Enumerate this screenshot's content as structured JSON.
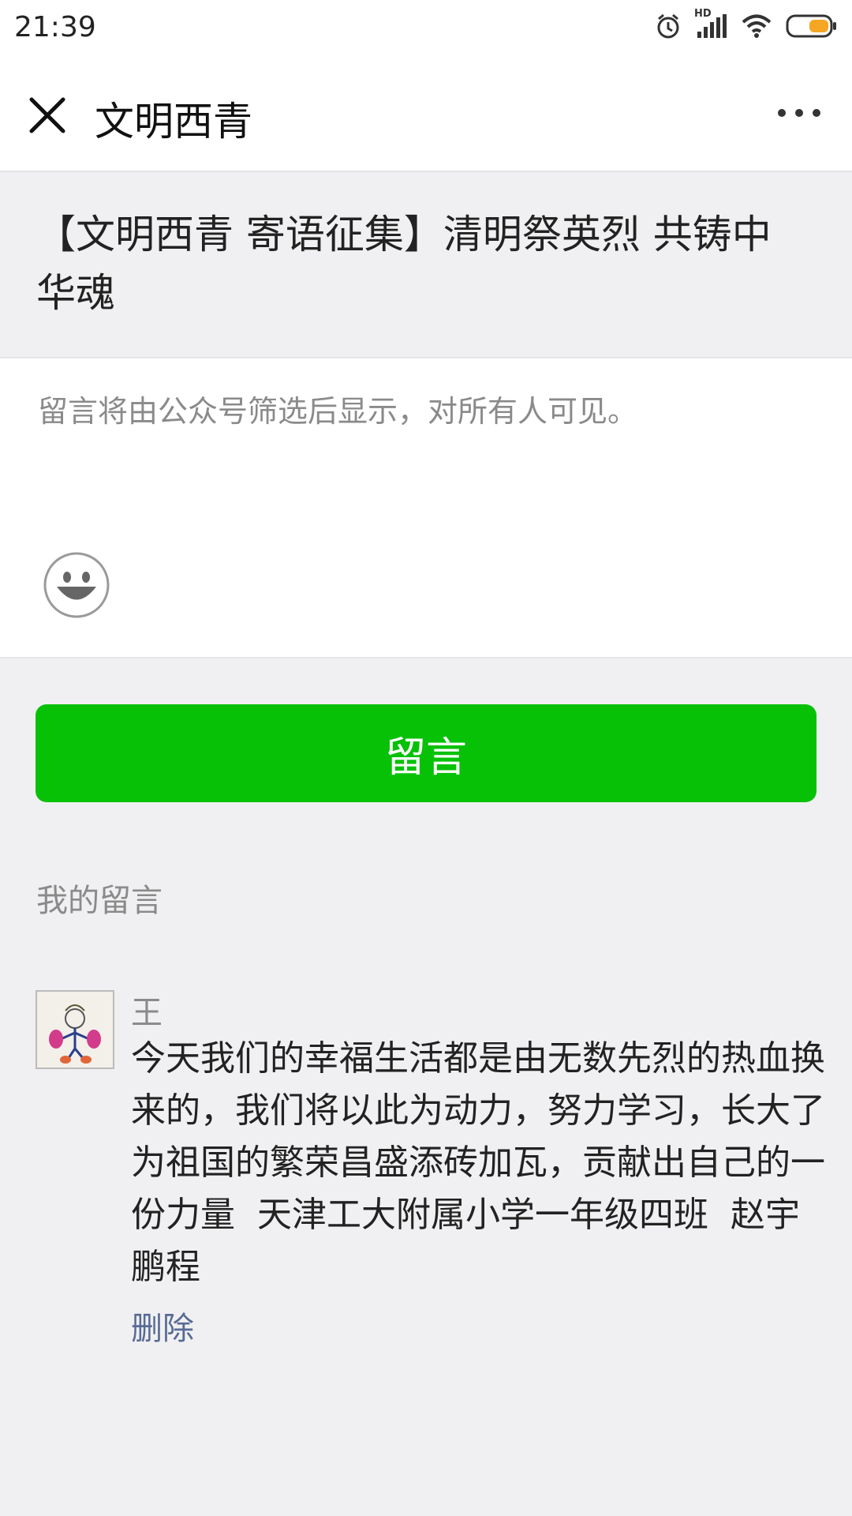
{
  "status_bar": {
    "time": "21:39",
    "hd_label": "HD",
    "icons": [
      "alarm-icon",
      "signal-icon",
      "wifi-icon",
      "battery-icon"
    ]
  },
  "nav": {
    "title": "文明西青",
    "close_icon": "close-icon",
    "more_icon": "more-icon"
  },
  "article": {
    "title": "【文明西青 寄语征集】清明祭英烈 共铸中华魂"
  },
  "comment_box": {
    "placeholder": "留言将由公众号筛选后显示，对所有人可见。",
    "emoji_icon": "emoji-icon"
  },
  "submit": {
    "label": "留言",
    "color": "#07c107"
  },
  "my_comments": {
    "section_title": "我的留言",
    "items": [
      {
        "author": "王",
        "text": "今天我们的幸福生活都是由无数先烈的热血换来的，我们将以此为动力，努力学习，长大了为祖国的繁荣昌盛添砖加瓦，贡献出自己的一份力量  天津工大附属小学一年级四班  赵宇鹏程",
        "delete_label": "删除",
        "link_color": "#576b95"
      }
    ]
  }
}
